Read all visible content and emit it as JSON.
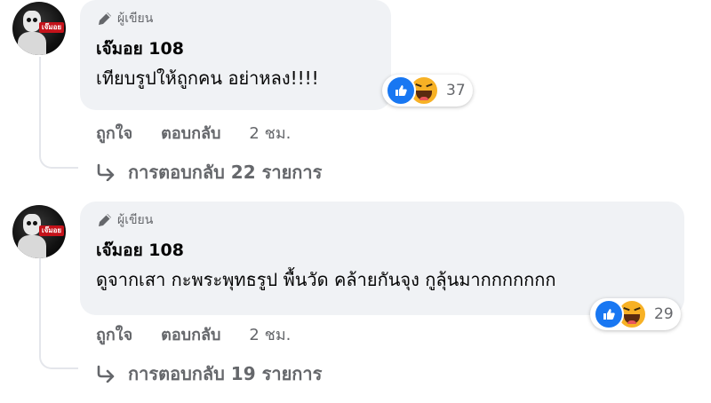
{
  "colors": {
    "bubble_bg": "#f0f2f5",
    "text": "#050505",
    "secondary_text": "#65676b",
    "like_blue": "#1877f2",
    "haha_yellow": "#f7b125",
    "avatar_tag_red": "#c4121a"
  },
  "comments": [
    {
      "avatar_icon": "profile-avatar-icon",
      "avatar_tag": "เจ๊มอย",
      "badge_icon": "pen-icon",
      "badge_label": "ผู้เขียน",
      "author": "เจ๊มอย 108",
      "text": "เทียบรูปให้ถูกคน อย่าหลง!!!!",
      "reactions": {
        "icons": [
          "like-icon",
          "haha-icon"
        ],
        "count": "37"
      },
      "actions": {
        "like": "ถูกใจ",
        "reply": "ตอบกลับ",
        "time": "2 ชม."
      },
      "replies_icon": "reply-arrow-icon",
      "replies_label": "การตอบกลับ 22 รายการ"
    },
    {
      "avatar_icon": "profile-avatar-icon",
      "avatar_tag": "เจ๊มอย",
      "badge_icon": "pen-icon",
      "badge_label": "ผู้เขียน",
      "author": "เจ๊มอย 108",
      "text": "ดูจากเสา กะพระพุทธรูป พื้นวัด คล้ายกันจุง กูลุ้นมากกกกกกก",
      "reactions": {
        "icons": [
          "like-icon",
          "haha-icon"
        ],
        "count": "29"
      },
      "actions": {
        "like": "ถูกใจ",
        "reply": "ตอบกลับ",
        "time": "2 ชม."
      },
      "replies_icon": "reply-arrow-icon",
      "replies_label": "การตอบกลับ 19 รายการ"
    }
  ]
}
